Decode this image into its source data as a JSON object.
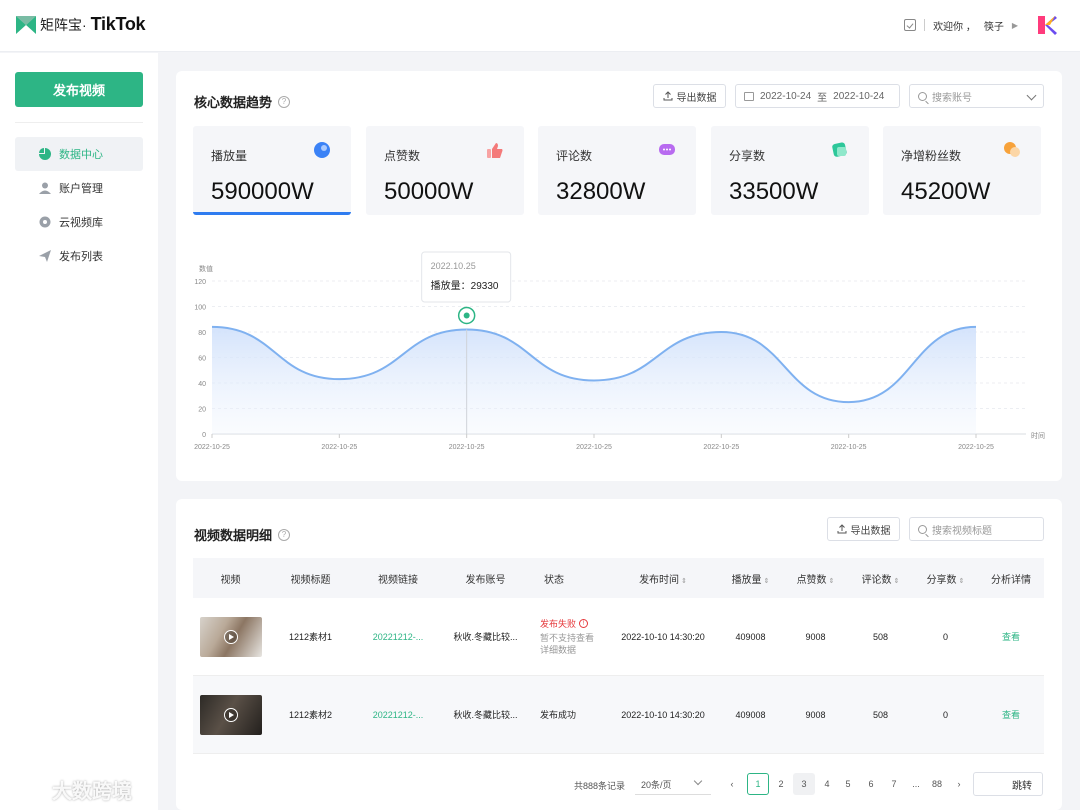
{
  "brand": {
    "cn": "矩阵宝·",
    "tiktok": "TikTok",
    "accent": "#2db585"
  },
  "header": {
    "welcome": "欢迎你 ，",
    "user": "筷子",
    "icons": [
      "todo-icon",
      "chevron-right-icon",
      "app-logo"
    ]
  },
  "sidebar": {
    "publish_label": "发布视频",
    "items": [
      {
        "label": "数据中心",
        "icon": "pie-chart-icon",
        "active": true
      },
      {
        "label": "账户管理",
        "icon": "user-icon",
        "active": false
      },
      {
        "label": "云视频库",
        "icon": "cloud-video-icon",
        "active": false
      },
      {
        "label": "发布列表",
        "icon": "send-icon",
        "active": false
      }
    ]
  },
  "trend": {
    "title": "核心数据趋势",
    "export_label": "导出数据",
    "date_start": "2022-10-24",
    "date_sep": "至",
    "date_end": "2022-10-24",
    "search_placeholder": "搜索账号",
    "kpis": [
      {
        "label": "播放量",
        "value": "590000W",
        "icon": "play-count-icon",
        "color": "#3b82f6",
        "active": true
      },
      {
        "label": "点赞数",
        "value": "50000W",
        "icon": "thumb-up-icon",
        "color": "#f47a7a",
        "active": false
      },
      {
        "label": "评论数",
        "value": "32800W",
        "icon": "comment-icon",
        "color": "#b86bf0",
        "active": false
      },
      {
        "label": "分享数",
        "value": "33500W",
        "icon": "share-icon",
        "color": "#2dc79a",
        "active": false
      },
      {
        "label": "净增粉丝数",
        "value": "45200W",
        "icon": "fans-icon",
        "color": "#f7a23b",
        "active": false
      }
    ]
  },
  "chart_data": {
    "type": "area",
    "ylabel": "数值",
    "xlabel": "时间",
    "ylim": [
      0,
      120
    ],
    "yticks": [
      0,
      20,
      40,
      60,
      80,
      100,
      120
    ],
    "categories": [
      "2022-10-25",
      "2022-10-25",
      "2022-10-25",
      "2022-10-25",
      "2022-10-25",
      "2022-10-25",
      "2022-10-25"
    ],
    "series": [
      {
        "values": [
          84,
          43,
          82,
          42,
          80,
          25,
          84
        ]
      }
    ],
    "color": "#7fb1f0",
    "tooltip": {
      "date": "2022.10.25",
      "label": "播放量：",
      "value": "29330",
      "index": 2
    },
    "grid": true
  },
  "detail": {
    "title": "视频数据明细",
    "export_label": "导出数据",
    "search_placeholder": "搜索视频标题",
    "columns": [
      "视频",
      "视频标题",
      "视频链接",
      "发布账号",
      "状态",
      "发布时间",
      "播放量",
      "点赞数",
      "评论数",
      "分享数",
      "分析详情"
    ],
    "rows": [
      {
        "title": "1212素材1",
        "link": "20221212-...",
        "account": "秋收.冬藏比较...",
        "status": "发布失败",
        "status_note1": "暂不支持查看",
        "status_note2": "详细数据",
        "time": "2022-10-10 14:30:20",
        "plays": "409008",
        "likes": "9008",
        "comments": "508",
        "shares": "0",
        "action": "查看"
      },
      {
        "title": "1212素材2",
        "link": "20221212-...",
        "account": "秋收.冬藏比较...",
        "status": "发布成功",
        "time": "2022-10-10 14:30:20",
        "plays": "409008",
        "likes": "9008",
        "comments": "508",
        "shares": "0",
        "action": "查看"
      }
    ]
  },
  "pager": {
    "total": "共888条记录",
    "page_size": "20条/页",
    "prev": "‹",
    "pages": [
      "1",
      "2",
      "3",
      "4",
      "5",
      "6",
      "7",
      "...",
      "88"
    ],
    "next": "›",
    "jump_label": "跳转"
  },
  "watermark": {
    "text": "大数跨境"
  }
}
